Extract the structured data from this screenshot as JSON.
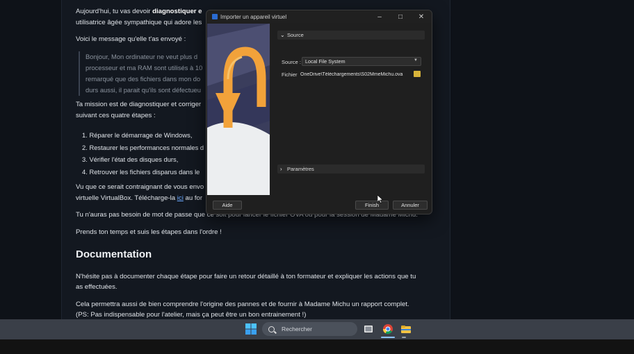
{
  "document": {
    "p1_prefix": "Aujourd'hui, tu vas devoir ",
    "p1_bold": "diagnostiquer e",
    "p1_line2": "utilisatrice âgée sympathique qui adore les",
    "p2": "Voici le message qu'elle t'as envoyé :",
    "quote_lines": [
      "Bonjour, Mon ordinateur ne veut plus d",
      "processeur et ma RAM sont utilisés à 10",
      "remarqué que des fichiers dans mon do",
      "durs aussi, il parait qu'ils sont défectueu"
    ],
    "p3_line1": "Ta mission est de diagnostiquer et corriger",
    "p3_line2": "suivant ces quatre étapes :",
    "steps": [
      "Réparer le démarrage de Windows,",
      "Restaurer les performances normales d",
      "Vérifier l'état des disques durs,",
      "Retrouver les fichiers disparus dans le"
    ],
    "p4_line1": "Vu que ce serait contraignant de vous envo",
    "p4_line2_prefix": "virtuelle VirtualBox. Télécharge-la ",
    "p4_link": "ici",
    "p4_line2_suffix": " au for",
    "p5": "Tu n'auras pas besoin de mot de passe que ce soit pour lancer le fichier OVA ou pour la session de Madame Michu.",
    "p6": "Prends ton temps et suis les étapes dans l'ordre !",
    "heading": "Documentation",
    "p7_line1": "N'hésite pas à documenter chaque étape pour faire un retour détaillé à ton formateur et expliquer les actions que tu",
    "p7_line2": "as effectuées.",
    "p8_line1": "Cela permettra aussi de bien comprendre l'origine des pannes et de fournir à Madame Michu un rapport complet.",
    "p8_line2": "(PS: Pas indispensable pour l'atelier, mais ça peut être un bon entrainement !)"
  },
  "dialog": {
    "title": "Importer un appareil virtuel",
    "source_section": "Source",
    "source_label": "Source :",
    "source_value": "Local File System",
    "file_label": "Fichier :",
    "file_value": "OneDrive\\Téléchargements\\S02MmeMichu.ova",
    "params_section": "Paramètres",
    "help_button": "Aide",
    "finish_button": "Finish",
    "cancel_button": "Annuler"
  },
  "taskbar": {
    "search_placeholder": "Rechercher"
  }
}
